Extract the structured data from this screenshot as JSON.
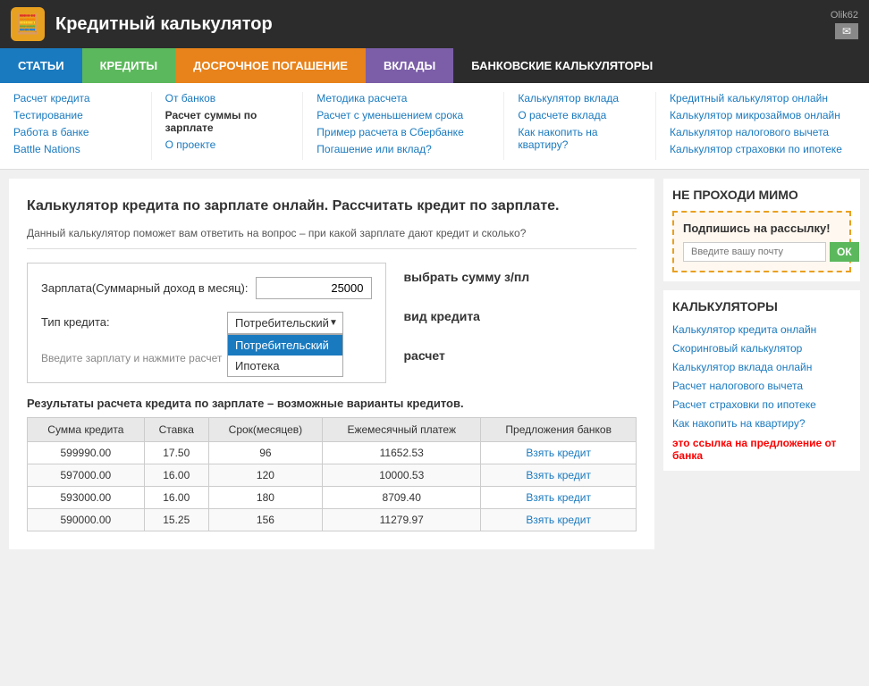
{
  "header": {
    "title": "Кредитный калькулятор",
    "icon": "🧮",
    "user": "Olik62",
    "email_icon": "✉"
  },
  "nav": {
    "items": [
      {
        "label": "СТАТЬИ",
        "color": "blue"
      },
      {
        "label": "КРЕДИТЫ",
        "color": "green"
      },
      {
        "label": "ДОСРОЧНОЕ ПОГАШЕНИЕ",
        "color": "orange"
      },
      {
        "label": "ВКЛАДЫ",
        "color": "purple"
      },
      {
        "label": "БАНКОВСКИЕ КАЛЬКУЛЯТОРЫ",
        "color": "dark"
      }
    ]
  },
  "dropdown": {
    "col1": {
      "links": [
        {
          "text": "Расчет кредита",
          "bold": false
        },
        {
          "text": "Тестирование",
          "bold": false
        },
        {
          "text": "Работа в банке",
          "bold": false
        },
        {
          "text": "Battle Nations",
          "bold": false
        }
      ]
    },
    "col2": {
      "links": [
        {
          "text": "От банков",
          "bold": false
        },
        {
          "text": "Расчет суммы по зарплате",
          "bold": true
        },
        {
          "text": "О проекте",
          "bold": false
        }
      ]
    },
    "col3": {
      "links": [
        {
          "text": "Методика расчета",
          "bold": false
        },
        {
          "text": "Расчет с уменьшением срока",
          "bold": false
        },
        {
          "text": "Пример расчета в Сбербанке",
          "bold": false
        },
        {
          "text": "Погашение или вклад?",
          "bold": false
        }
      ]
    },
    "col4": {
      "links": [
        {
          "text": "Калькулятор вклада",
          "bold": false
        },
        {
          "text": "О расчете вклада",
          "bold": false
        },
        {
          "text": "Как накопить на квартиру?",
          "bold": false
        }
      ]
    },
    "col5": {
      "links": [
        {
          "text": "Кредитный калькулятор онлайн",
          "bold": false
        },
        {
          "text": "Калькулятор микрозаймов онлайн",
          "bold": false
        },
        {
          "text": "Калькулятор налогового вычета",
          "bold": false
        },
        {
          "text": "Калькулятор страховки по ипотеке",
          "bold": false
        }
      ]
    }
  },
  "main": {
    "title": "Калькулятор кредита по зарплате онлайн. Рассчитать кредит по зарплате.",
    "description": "Данный калькулятор поможет вам ответить на вопрос – при какой зарплате дают кредит и сколько?",
    "form": {
      "salary_label": "Зарплата(Суммарный доход в месяц):",
      "salary_value": "25000",
      "credit_type_label": "Тип кредита:",
      "credit_type_value": "Потребительский",
      "credit_type_options": [
        "Потребительский",
        "Ипотека"
      ],
      "hint": "Введите зарплату и нажмите расчет",
      "side_salary": "выбрать сумму з/пл",
      "side_type": "вид кредита",
      "side_hint": "расчет"
    },
    "results": {
      "title": "Результаты расчета кредита по зарплате – возможные варианты кредитов.",
      "headers": [
        "Сумма кредита",
        "Ставка",
        "Срок(месяцев)",
        "Ежемесячный платеж",
        "Предложения банков"
      ],
      "rows": [
        {
          "amount": "599990.00",
          "rate": "17.50",
          "term": "96",
          "payment": "11652.53",
          "link": "Взять кредит"
        },
        {
          "amount": "597000.00",
          "rate": "16.00",
          "term": "120",
          "payment": "10000.53",
          "link": "Взять кредит"
        },
        {
          "amount": "593000.00",
          "rate": "16.00",
          "term": "180",
          "payment": "8709.40",
          "link": "Взять кредит"
        },
        {
          "amount": "590000.00",
          "rate": "15.25",
          "term": "156",
          "payment": "11279.97",
          "link": "Взять кредит"
        }
      ]
    }
  },
  "sidebar": {
    "newsletter": {
      "title": "НЕ ПРОХОДИ МИМО",
      "label": "Подпишись на рассылку!",
      "placeholder": "Введите вашу почту",
      "btn": "ОК"
    },
    "calculators": {
      "title": "КАЛЬКУЛЯТОРЫ",
      "links": [
        "Калькулятор кредита онлайн",
        "Скоринговый калькулятор",
        "Калькулятор вклада онлайн",
        "Расчет налогового вычета",
        "Расчет страховки по ипотеке",
        "Как накопить на квартиру?"
      ]
    },
    "opros_note": "это ссылка на предложение от банка"
  }
}
